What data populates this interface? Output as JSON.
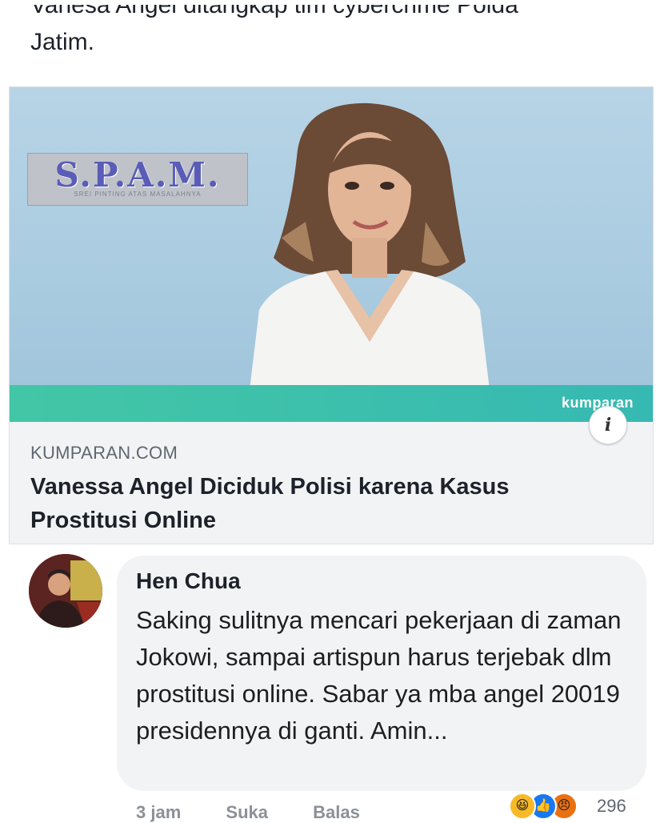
{
  "post": {
    "text_cut": "Vanesa Angel ditangkap tim cybercrime Polda",
    "text_line2": "Jatim."
  },
  "link_card": {
    "image_logo": "S.P.A.M.",
    "image_logo_sub": "SREI PINTING ATAS MASALAHNYA",
    "image_brand": "kumparan",
    "source": "KUMPARAN.COM",
    "headline": "Vanessa Angel Diciduk Polisi karena Kasus Prostitusi Online",
    "info_icon": "info-icon"
  },
  "comment": {
    "author": "Hen Chua",
    "text": "Saking sulitnya mencari pekerjaan di zaman Jokowi, sampai artispun harus terjebak dlm prostitusi online. Sabar ya mba angel 20019 presidennya di ganti. Amin...",
    "time": "3 jam",
    "like": "Suka",
    "reply": "Balas",
    "reactions_count": "296",
    "reaction_icons": [
      "haha-icon",
      "like-icon",
      "angry-icon"
    ]
  },
  "colors": {
    "bubble": "#f2f3f5",
    "teal": "#43c6a6",
    "like_blue": "#1877f2"
  }
}
